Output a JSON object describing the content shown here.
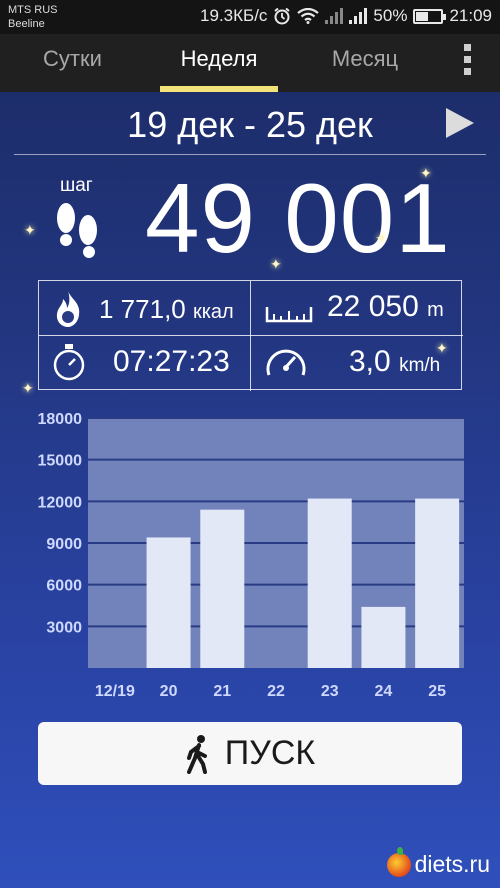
{
  "status_bar": {
    "carrier_line1": "MTS RUS",
    "carrier_line2": "Beeline",
    "speed": "19.3КБ/с",
    "battery": "50%",
    "time": "21:09",
    "icons": [
      "alarm-icon",
      "wifi-icon",
      "signal-icon",
      "battery-icon"
    ]
  },
  "tabs": [
    {
      "label": "Сутки",
      "active": false
    },
    {
      "label": "Неделя",
      "active": true
    },
    {
      "label": "Месяц",
      "active": false
    }
  ],
  "date_range": "19 дек - 25 дек",
  "steps": {
    "label": "шаг",
    "value": "49 001"
  },
  "stats": {
    "calories": {
      "value": "1 771,0",
      "unit": "ккал"
    },
    "distance": {
      "value": "22 050",
      "unit": "m"
    },
    "duration": {
      "value": "07:27:23"
    },
    "speed": {
      "value": "3,0",
      "unit": "km/h"
    }
  },
  "chart_data": {
    "type": "bar",
    "categories": [
      "12/19",
      "20",
      "21",
      "22",
      "23",
      "24",
      "25"
    ],
    "values": [
      0,
      9400,
      11400,
      0,
      12200,
      4400,
      12200
    ],
    "ylim": [
      0,
      18000
    ],
    "yticks": [
      "3000",
      "6000",
      "9000",
      "12000",
      "15000",
      "18000"
    ],
    "grid": true,
    "colors": {
      "bar": "#e3e8f6",
      "plot_bg": "#7283bc",
      "grid": "#2a3b86",
      "labels": "#cfd8ff"
    }
  },
  "start_button": {
    "label": "ПУСК"
  },
  "watermark": "diets.ru"
}
